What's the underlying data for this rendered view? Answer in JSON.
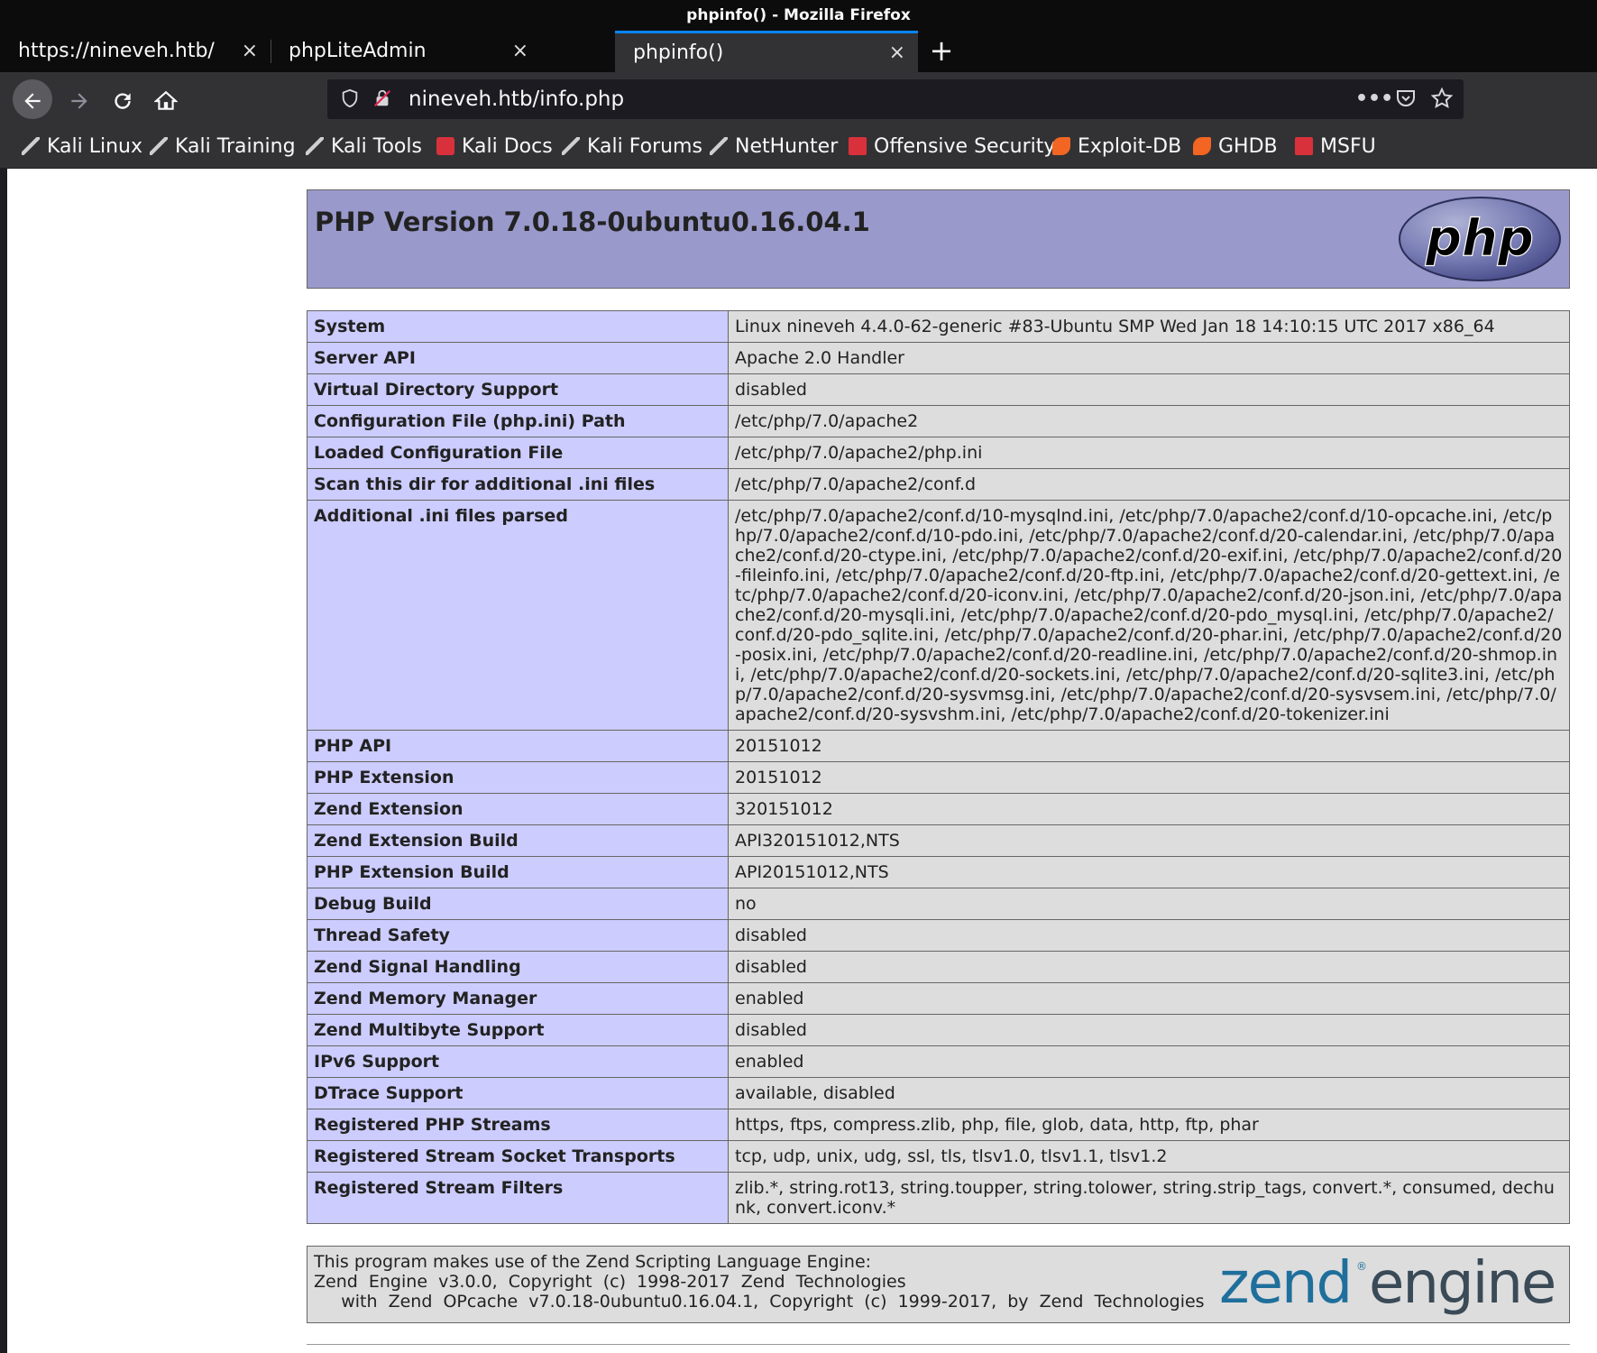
{
  "window": {
    "title": "phpinfo() - Mozilla Firefox"
  },
  "tabs": [
    {
      "label": "https://nineveh.htb/",
      "selected": false
    },
    {
      "label": "phpLiteAdmin",
      "selected": false
    },
    {
      "label": "phpinfo()",
      "selected": true
    }
  ],
  "tab_close_glyph": "×",
  "new_tab_glyph": "+",
  "nav": {
    "url": "nineveh.htb/info.php"
  },
  "bookmarks": [
    {
      "label": "Kali Linux",
      "icon": "kali-dragon-icon"
    },
    {
      "label": "Kali Training",
      "icon": "kali-dragon-icon"
    },
    {
      "label": "Kali Tools",
      "icon": "kali-dragon-icon"
    },
    {
      "label": "Kali Docs",
      "icon": "kali-docs-icon"
    },
    {
      "label": "Kali Forums",
      "icon": "kali-dragon-icon"
    },
    {
      "label": "NetHunter",
      "icon": "kali-dragon-icon"
    },
    {
      "label": "Offensive Security",
      "icon": "offsec-icon"
    },
    {
      "label": "Exploit-DB",
      "icon": "exploit-db-icon"
    },
    {
      "label": "GHDB",
      "icon": "exploit-db-icon"
    },
    {
      "label": "MSFU",
      "icon": "offsec-icon"
    }
  ],
  "php": {
    "title": "PHP Version 7.0.18-0ubuntu0.16.04.1",
    "logo_text": "php",
    "rows": [
      {
        "key": "System",
        "value": "Linux nineveh 4.4.0-62-generic #83-Ubuntu SMP Wed Jan 18 14:10:15 UTC 2017 x86_64"
      },
      {
        "key": "Server API",
        "value": "Apache 2.0 Handler"
      },
      {
        "key": "Virtual Directory Support",
        "value": "disabled"
      },
      {
        "key": "Configuration File (php.ini) Path",
        "value": "/etc/php/7.0/apache2"
      },
      {
        "key": "Loaded Configuration File",
        "value": "/etc/php/7.0/apache2/php.ini"
      },
      {
        "key": "Scan this dir for additional .ini files",
        "value": "/etc/php/7.0/apache2/conf.d"
      },
      {
        "key": "Additional .ini files parsed",
        "value": "/etc/php/7.0/apache2/conf.d/10-mysqlnd.ini, /etc/php/7.0/apache2/conf.d/10-opcache.ini, /etc/php/7.0/apache2/conf.d/10-pdo.ini, /etc/php/7.0/apache2/conf.d/20-calendar.ini, /etc/php/7.0/apache2/conf.d/20-ctype.ini, /etc/php/7.0/apache2/conf.d/20-exif.ini, /etc/php/7.0/apache2/conf.d/20-fileinfo.ini, /etc/php/7.0/apache2/conf.d/20-ftp.ini, /etc/php/7.0/apache2/conf.d/20-gettext.ini, /etc/php/7.0/apache2/conf.d/20-iconv.ini, /etc/php/7.0/apache2/conf.d/20-json.ini, /etc/php/7.0/apache2/conf.d/20-mysqli.ini, /etc/php/7.0/apache2/conf.d/20-pdo_mysql.ini, /etc/php/7.0/apache2/conf.d/20-pdo_sqlite.ini, /etc/php/7.0/apache2/conf.d/20-phar.ini, /etc/php/7.0/apache2/conf.d/20-posix.ini, /etc/php/7.0/apache2/conf.d/20-readline.ini, /etc/php/7.0/apache2/conf.d/20-shmop.ini, /etc/php/7.0/apache2/conf.d/20-sockets.ini, /etc/php/7.0/apache2/conf.d/20-sqlite3.ini, /etc/php/7.0/apache2/conf.d/20-sysvmsg.ini, /etc/php/7.0/apache2/conf.d/20-sysvsem.ini, /etc/php/7.0/apache2/conf.d/20-sysvshm.ini, /etc/php/7.0/apache2/conf.d/20-tokenizer.ini"
      },
      {
        "key": "PHP API",
        "value": "20151012"
      },
      {
        "key": "PHP Extension",
        "value": "20151012"
      },
      {
        "key": "Zend Extension",
        "value": "320151012"
      },
      {
        "key": "Zend Extension Build",
        "value": "API320151012,NTS"
      },
      {
        "key": "PHP Extension Build",
        "value": "API20151012,NTS"
      },
      {
        "key": "Debug Build",
        "value": "no"
      },
      {
        "key": "Thread Safety",
        "value": "disabled"
      },
      {
        "key": "Zend Signal Handling",
        "value": "disabled"
      },
      {
        "key": "Zend Memory Manager",
        "value": "enabled"
      },
      {
        "key": "Zend Multibyte Support",
        "value": "disabled"
      },
      {
        "key": "IPv6 Support",
        "value": "enabled"
      },
      {
        "key": "DTrace Support",
        "value": "available, disabled"
      },
      {
        "key": "Registered PHP Streams",
        "value": "https, ftps, compress.zlib, php, file, glob, data, http, ftp, phar"
      },
      {
        "key": "Registered Stream Socket Transports",
        "value": "tcp, udp, unix, udg, ssl, tls, tlsv1.0, tlsv1.1, tlsv1.2"
      },
      {
        "key": "Registered Stream Filters",
        "value": "zlib.*, string.rot13, string.toupper, string.tolower, string.strip_tags, convert.*, consumed, dechunk, convert.iconv.*"
      }
    ]
  },
  "zend": {
    "line1": "This program makes use of the Zend Scripting Language Engine:",
    "line2": "Zend  Engine  v3.0.0,  Copyright  (c)  1998-2017  Zend  Technologies",
    "line3": "     with  Zend  OPcache  v7.0.18-0ubuntu0.16.04.1,  Copyright  (c)  1999-2017,  by  Zend  Technologies",
    "logo_text_1": "zend",
    "logo_reg": "®",
    "logo_text_2": "engine"
  },
  "colors": {
    "header_bg": "#9999cc",
    "key_bg": "#ccccff",
    "value_bg": "#dddddd",
    "firefox_dark": "#0c0c0d",
    "firefox_toolbar": "#323234",
    "tab_accent": "#0a84ff"
  }
}
